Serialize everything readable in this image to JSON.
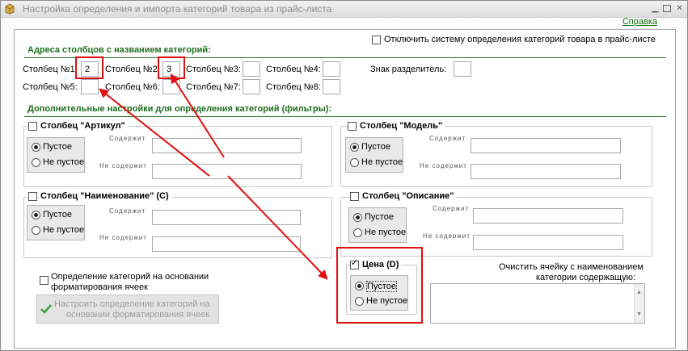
{
  "window": {
    "title": "Настройка определения и импорта категорий товара из прайс-листа",
    "help_link": "Справка"
  },
  "disable_checkbox": {
    "label": "Отключить систему определения категорий товара в прайс-листе",
    "checked": false
  },
  "columns_section": {
    "heading": "Адреса столбцов с названием категорий:",
    "row1": [
      {
        "label": "Столбец №1:",
        "value": "2"
      },
      {
        "label": "Столбец №2:",
        "value": "3"
      },
      {
        "label": "Столбец №3:",
        "value": ""
      },
      {
        "label": "Столбец №4:",
        "value": ""
      }
    ],
    "row2": [
      {
        "label": "Столбец №5:",
        "value": ""
      },
      {
        "label": "Столбец №6:",
        "value": ""
      },
      {
        "label": "Столбец №7:",
        "value": ""
      },
      {
        "label": "Столбец №8:",
        "value": ""
      }
    ],
    "separator_label": "Знак разделитель:",
    "separator_value": ""
  },
  "filters_section": {
    "heading": "Дополнительные настройки для определения категорий (фильтры):",
    "empty_option": "Пустое",
    "not_empty_option": "Не пустое",
    "contains_label": "Содержит",
    "not_contains_label": "Не содержит",
    "groups": {
      "article": {
        "title": "Столбец \"Артикул\"",
        "checked": false,
        "selected": "empty"
      },
      "model": {
        "title": "Столбец \"Модель\"",
        "checked": false,
        "selected": "empty"
      },
      "name": {
        "title": "Столбец \"Наименование\" (С)",
        "checked": false,
        "selected": "empty"
      },
      "description": {
        "title": "Столбец \"Описание\"",
        "checked": false,
        "selected": "empty"
      },
      "price": {
        "title": "Цена (D)",
        "checked": true,
        "selected": "empty"
      }
    }
  },
  "formatting": {
    "checkbox_label_line1": "Определение категорий на основании",
    "checkbox_label_line2": "форматирования ячеек",
    "button_line1": "Настроить определение категорий на",
    "button_line2": "основании форматирования ячеек"
  },
  "clear_cell": {
    "label_line1": "Очистить ячейку с наименованием",
    "label_line2": "категории содержащую:"
  },
  "colors": {
    "heading_green": "#1f6d1f",
    "annotation_red": "#e01010"
  }
}
